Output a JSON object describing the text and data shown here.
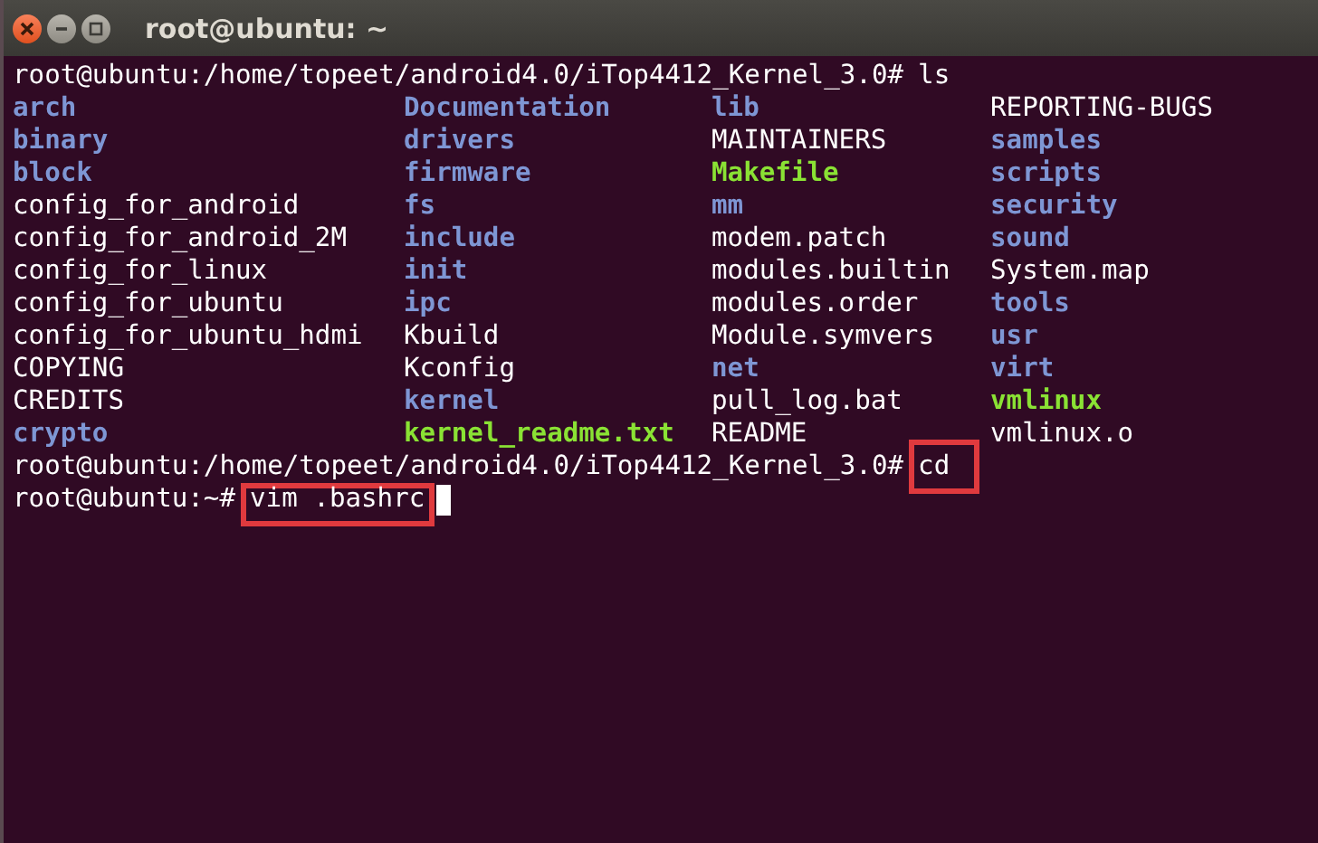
{
  "window": {
    "title": "root@ubuntu: ~"
  },
  "terminal": {
    "lines": [
      {
        "kind": "prompt",
        "prompt": "root@ubuntu:/home/topeet/android4.0/iTop4412_Kernel_3.0#",
        "command": "ls",
        "highlighted": false,
        "cursor": false
      },
      {
        "kind": "listing",
        "files": [
          {
            "name": "arch",
            "kind": "dir"
          },
          {
            "name": "Documentation",
            "kind": "dir"
          },
          {
            "name": "lib",
            "kind": "dir"
          },
          {
            "name": "REPORTING-BUGS",
            "kind": "file"
          },
          {
            "name": "binary",
            "kind": "dir"
          },
          {
            "name": "drivers",
            "kind": "dir"
          },
          {
            "name": "MAINTAINERS",
            "kind": "file"
          },
          {
            "name": "samples",
            "kind": "dir"
          },
          {
            "name": "block",
            "kind": "dir"
          },
          {
            "name": "firmware",
            "kind": "dir"
          },
          {
            "name": "Makefile",
            "kind": "exec"
          },
          {
            "name": "scripts",
            "kind": "dir"
          },
          {
            "name": "config_for_android",
            "kind": "file"
          },
          {
            "name": "fs",
            "kind": "dir"
          },
          {
            "name": "mm",
            "kind": "dir"
          },
          {
            "name": "security",
            "kind": "dir"
          },
          {
            "name": "config_for_android_2M",
            "kind": "file"
          },
          {
            "name": "include",
            "kind": "dir"
          },
          {
            "name": "modem.patch",
            "kind": "file"
          },
          {
            "name": "sound",
            "kind": "dir"
          },
          {
            "name": "config_for_linux",
            "kind": "file"
          },
          {
            "name": "init",
            "kind": "dir"
          },
          {
            "name": "modules.builtin",
            "kind": "file"
          },
          {
            "name": "System.map",
            "kind": "file"
          },
          {
            "name": "config_for_ubuntu",
            "kind": "file"
          },
          {
            "name": "ipc",
            "kind": "dir"
          },
          {
            "name": "modules.order",
            "kind": "file"
          },
          {
            "name": "tools",
            "kind": "dir"
          },
          {
            "name": "config_for_ubuntu_hdmi",
            "kind": "file"
          },
          {
            "name": "Kbuild",
            "kind": "file"
          },
          {
            "name": "Module.symvers",
            "kind": "file"
          },
          {
            "name": "usr",
            "kind": "dir"
          },
          {
            "name": "COPYING",
            "kind": "file"
          },
          {
            "name": "Kconfig",
            "kind": "file"
          },
          {
            "name": "net",
            "kind": "dir"
          },
          {
            "name": "virt",
            "kind": "dir"
          },
          {
            "name": "CREDITS",
            "kind": "file"
          },
          {
            "name": "kernel",
            "kind": "dir"
          },
          {
            "name": "pull_log.bat",
            "kind": "file"
          },
          {
            "name": "vmlinux",
            "kind": "exec"
          },
          {
            "name": "crypto",
            "kind": "dir"
          },
          {
            "name": "kernel_readme.txt",
            "kind": "exec"
          },
          {
            "name": "README",
            "kind": "file"
          },
          {
            "name": "vmlinux.o",
            "kind": "file"
          }
        ]
      },
      {
        "kind": "prompt",
        "prompt": "root@ubuntu:/home/topeet/android4.0/iTop4412_Kernel_3.0#",
        "command": "cd",
        "highlighted": true,
        "cursor": false
      },
      {
        "kind": "prompt",
        "prompt": "root@ubuntu:~#",
        "command": "vim .bashrc",
        "highlighted": true,
        "cursor": true
      }
    ]
  }
}
